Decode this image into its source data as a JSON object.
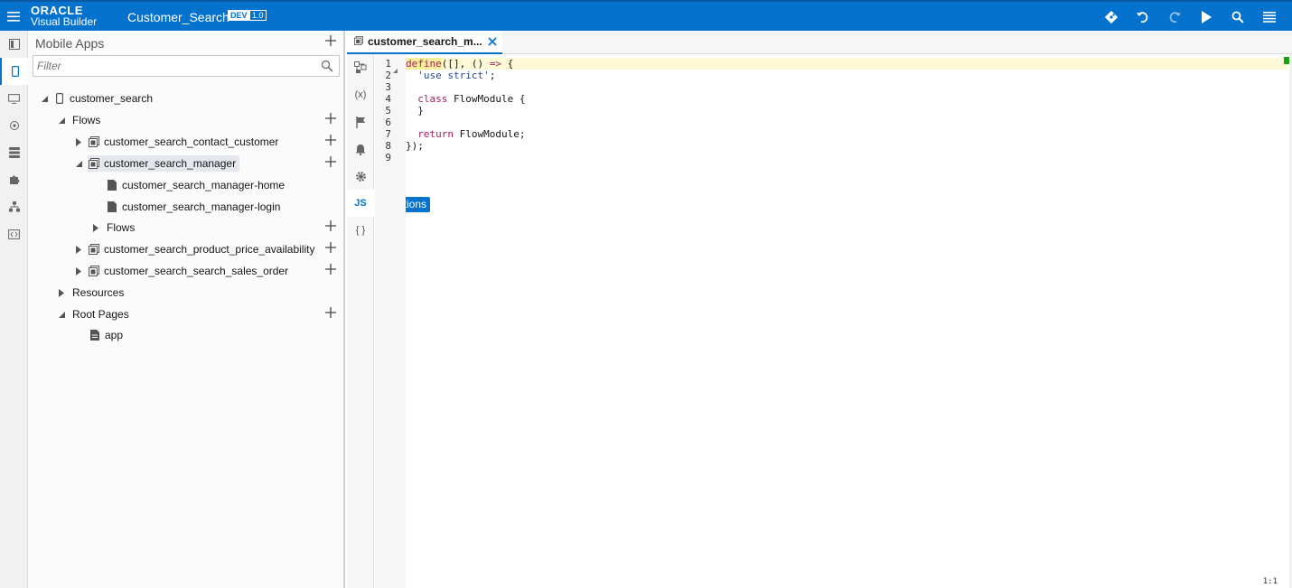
{
  "header": {
    "brand_line1": "ORACLE",
    "brand_line2": "Visual Builder",
    "app_name": "Customer_Search",
    "env_badge": "DEV",
    "version_badge": "1.0",
    "accent": "#0572ce"
  },
  "navigator": {
    "title": "Mobile Apps",
    "filter_placeholder": "Filter",
    "tree": {
      "root": "customer_search",
      "flows": "Flows",
      "flow_contact": "customer_search_contact_customer",
      "flow_manager": "customer_search_manager",
      "page_home": "customer_search_manager-home",
      "page_login": "customer_search_manager-login",
      "sub_flows": "Flows",
      "flow_product": "customer_search_product_price_availability",
      "flow_sales": "customer_search_search_sales_order",
      "resources": "Resources",
      "root_pages": "Root Pages",
      "app": "app"
    }
  },
  "editor": {
    "tab_label": "customer_search_m...",
    "tooltip": "Functions",
    "js_label": "JS",
    "braces_label": "{ }",
    "vars_label": "(x)",
    "cursor_pos": "1:1",
    "line_numbers": [
      "1",
      "2",
      "3",
      "4",
      "5",
      "6",
      "7",
      "8",
      "9"
    ],
    "code": {
      "l1_define": "define",
      "l1_rest": "([], () ",
      "l1_arrow": "=>",
      "l1_end": " {",
      "l2_str": "'use strict'",
      "l2_end": ";",
      "l4_kw": "class",
      "l4_rest": " FlowModule {",
      "l5": "}",
      "l7_kw": "return",
      "l7_rest": " FlowModule;",
      "l8": "});"
    }
  }
}
